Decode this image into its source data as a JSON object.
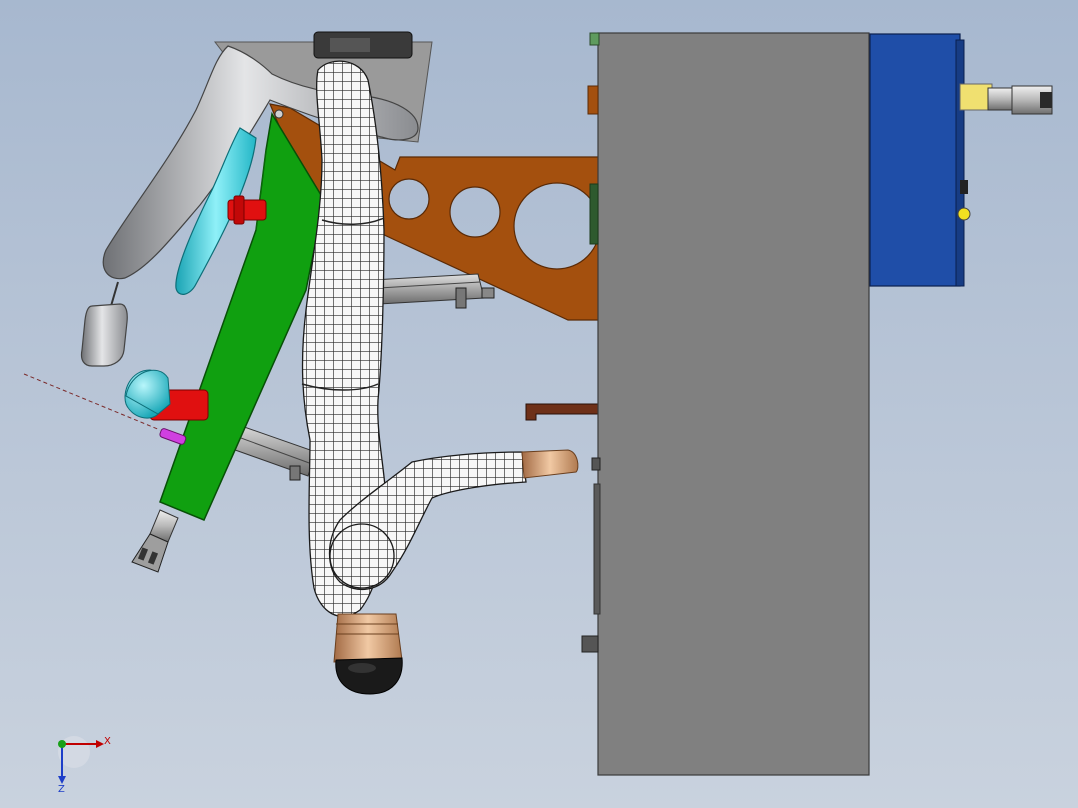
{
  "viewport": {
    "background_top": "#a7b8cf",
    "background_bottom": "#c9d2de"
  },
  "triad": {
    "x_label": "X",
    "z_label": "Z",
    "y_label": "",
    "x_color": "#c00000",
    "y_color": "#18a018",
    "z_color": "#1d3ec8"
  },
  "parts": {
    "panel_color": "#808080",
    "enclosure_color": "#1f4ea8",
    "bracket_color": "#a4500e",
    "arm_color": "#10a010",
    "handle_color": "#a9aaad",
    "lens_color": "#29c8d8",
    "knob_color": "#e01010",
    "tip_color": "#d2a27a",
    "cap_color": "#1a1a1a",
    "mesh_color": "#f5f5f5"
  }
}
